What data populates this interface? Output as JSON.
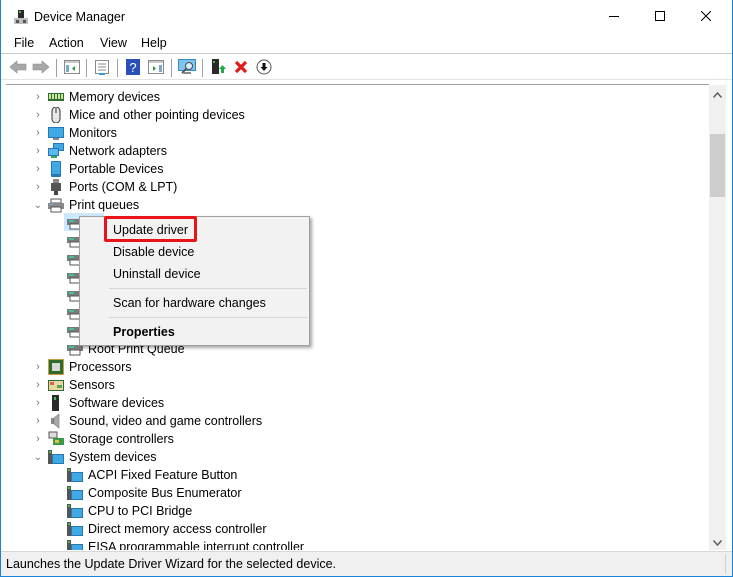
{
  "window": {
    "title": "Device Manager",
    "controls": {
      "minimize": "minimize",
      "maximize": "maximize",
      "close": "close"
    }
  },
  "menubar": [
    "File",
    "Action",
    "View",
    "Help"
  ],
  "toolbar": {
    "buttons": [
      {
        "icon": "back-arrow-icon",
        "label": "Back"
      },
      {
        "icon": "forward-arrow-icon",
        "label": "Forward"
      },
      {
        "icon": "show-hide-console-tree-icon",
        "label": "Show/Hide Console Tree"
      },
      {
        "icon": "properties-icon",
        "label": "Properties"
      },
      {
        "icon": "help-icon",
        "label": "Help"
      },
      {
        "icon": "show-hide-action-pane-icon",
        "label": "Show/Hide Action Pane"
      },
      {
        "icon": "scan-hardware-icon",
        "label": "Scan for hardware changes"
      },
      {
        "icon": "update-driver-icon",
        "label": "Update driver"
      },
      {
        "icon": "uninstall-device-icon",
        "label": "Uninstall device"
      },
      {
        "icon": "disable-device-icon",
        "label": "Disable device"
      }
    ]
  },
  "tree": {
    "categories_top": [
      {
        "label": "Memory devices",
        "icon": "memory-icon",
        "expanded": false
      },
      {
        "label": "Mice and other pointing devices",
        "icon": "mouse-icon",
        "expanded": false
      },
      {
        "label": "Monitors",
        "icon": "monitor-icon",
        "expanded": false
      },
      {
        "label": "Network adapters",
        "icon": "network-icon",
        "expanded": false
      },
      {
        "label": "Portable Devices",
        "icon": "portable-device-icon",
        "expanded": false
      },
      {
        "label": "Ports (COM & LPT)",
        "icon": "port-icon",
        "expanded": false
      },
      {
        "label": "Print queues",
        "icon": "printer-icon",
        "expanded": true
      }
    ],
    "print_queue_children_count": 8,
    "print_queue_last_visible": "Root Print Queue",
    "categories_bottom": [
      {
        "label": "Processors",
        "icon": "processor-icon",
        "expanded": false
      },
      {
        "label": "Sensors",
        "icon": "sensor-icon",
        "expanded": false
      },
      {
        "label": "Software devices",
        "icon": "software-device-icon",
        "expanded": false
      },
      {
        "label": "Sound, video and game controllers",
        "icon": "speaker-icon",
        "expanded": false
      },
      {
        "label": "Storage controllers",
        "icon": "storage-icon",
        "expanded": false
      },
      {
        "label": "System devices",
        "icon": "system-device-icon",
        "expanded": true
      }
    ],
    "system_devices": [
      "ACPI Fixed Feature Button",
      "Composite Bus Enumerator",
      "CPU to PCI Bridge",
      "Direct memory access controller",
      "EISA programmable interrupt controller"
    ]
  },
  "context_menu": {
    "items": [
      {
        "label": "Update driver",
        "highlighted": true
      },
      {
        "label": "Disable device"
      },
      {
        "label": "Uninstall device"
      },
      {
        "label": "Scan for hardware changes"
      },
      {
        "label": "Properties",
        "bold": true
      }
    ]
  },
  "statusbar": {
    "text": "Launches the Update Driver Wizard for the selected device."
  },
  "colors": {
    "highlight_box": "#e8141a",
    "window_border": "#1883d7",
    "selection": "#cce8ff"
  }
}
